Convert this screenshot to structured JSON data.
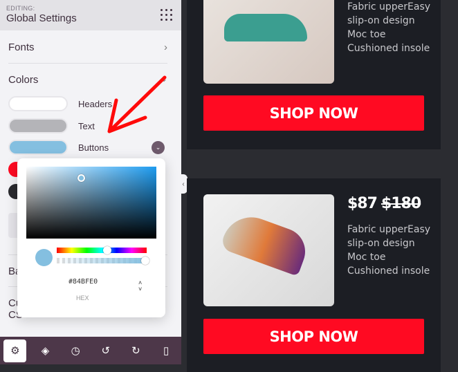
{
  "panel": {
    "editing_label": "EDITING:",
    "title": "Global Settings",
    "sections": {
      "fonts": "Fonts",
      "colors": "Colors",
      "background": "Background",
      "custom": "Custom CSS"
    },
    "swatches": [
      {
        "label": "Headers",
        "color": "#ffffff"
      },
      {
        "label": "Text",
        "color": "#b4b4b8"
      },
      {
        "label": "Buttons",
        "color": "#84bfe0"
      }
    ],
    "extra_colors": [
      "#ff0a22",
      "#2a2a2e"
    ]
  },
  "picker": {
    "hex_value": "#84BFE0",
    "format_label": "HEX",
    "hue_position": 0.56,
    "alpha": 1.0
  },
  "toolbar": {
    "items": [
      "settings",
      "layers",
      "history",
      "undo",
      "redo",
      "mobile-preview"
    ]
  },
  "products": [
    {
      "features": [
        "Fabric upperEasy",
        "slip-on design",
        "Moc toe",
        "Cushioned insole"
      ],
      "button": "SHOP NOW"
    },
    {
      "price": "$87",
      "old_price": "$180",
      "features": [
        "Fabric upperEasy",
        "slip-on design",
        "Moc toe",
        "Cushioned insole"
      ],
      "button": "SHOP NOW"
    }
  ],
  "colors": {
    "accent": "#ff0a22",
    "toolbar": "#4d3749",
    "card": "#1c1e24"
  }
}
